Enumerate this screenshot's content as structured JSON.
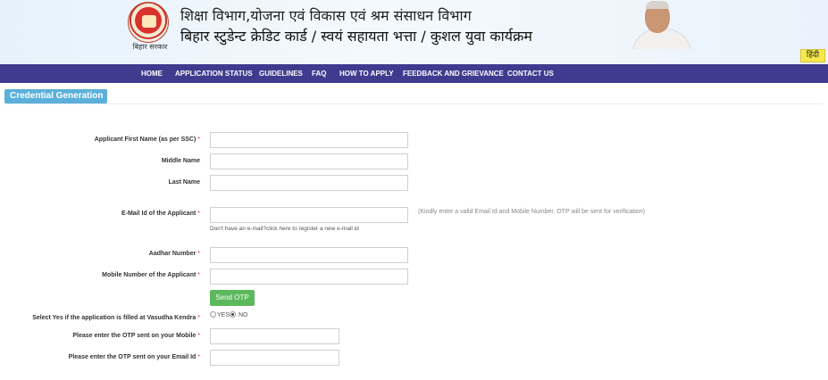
{
  "header": {
    "logo_caption": "बिहार सरकार",
    "department": "शिक्षा विभाग,योजना एवं विकास एवं श्रम संसाधन विभाग",
    "schemes": "बिहार स्टुडेन्ट क्रेडिट कार्ड / स्वयं सहायता भत्ता / कुशल युवा कार्यक्रम",
    "language_button": "हिंदी"
  },
  "nav": {
    "items": [
      "HOME",
      "APPLICATION STATUS",
      "GUIDELINES",
      "FAQ",
      "HOW TO APPLY",
      "FEEDBACK AND GRIEVANCE",
      "CONTACT US"
    ]
  },
  "section": {
    "title": "Credential Generation"
  },
  "form": {
    "first_name_label": "Applicant First Name (as per SSC)",
    "middle_name_label": "Middle Name",
    "last_name_label": "Last Name",
    "email_label": "E-Mail Id of the Applicant",
    "email_hint": "(Kindly enter a valid Email Id and Mobile Number. OTP will be sent for verification)",
    "no_email_text": "Don't have an e-mail?",
    "register_email_link": "click here to register a new e-mail id",
    "aadhar_label": "Aadhar Number",
    "mobile_label": "Mobile Number of the Applicant",
    "send_otp_label": "Send OTP",
    "vasudha_label": "Select Yes if the application is filled at Vasudha Kendra",
    "yes_label": "YES",
    "no_label": "NO",
    "vasudha_selected": "NO",
    "otp_mobile_label": "Please enter the OTP sent on your Mobile",
    "otp_email_label": "Please enter the OTP sent on your Email Id",
    "required_mark": "*"
  },
  "colors": {
    "nav_bg": "#3f3b8f",
    "section_tab": "#5bb0d9",
    "otp_button": "#5cb85c",
    "language_button": "#f7e84b",
    "required": "#dd2222"
  },
  "icons": {
    "logo": "bihar-government-emblem",
    "portrait": "chief-minister-portrait"
  }
}
